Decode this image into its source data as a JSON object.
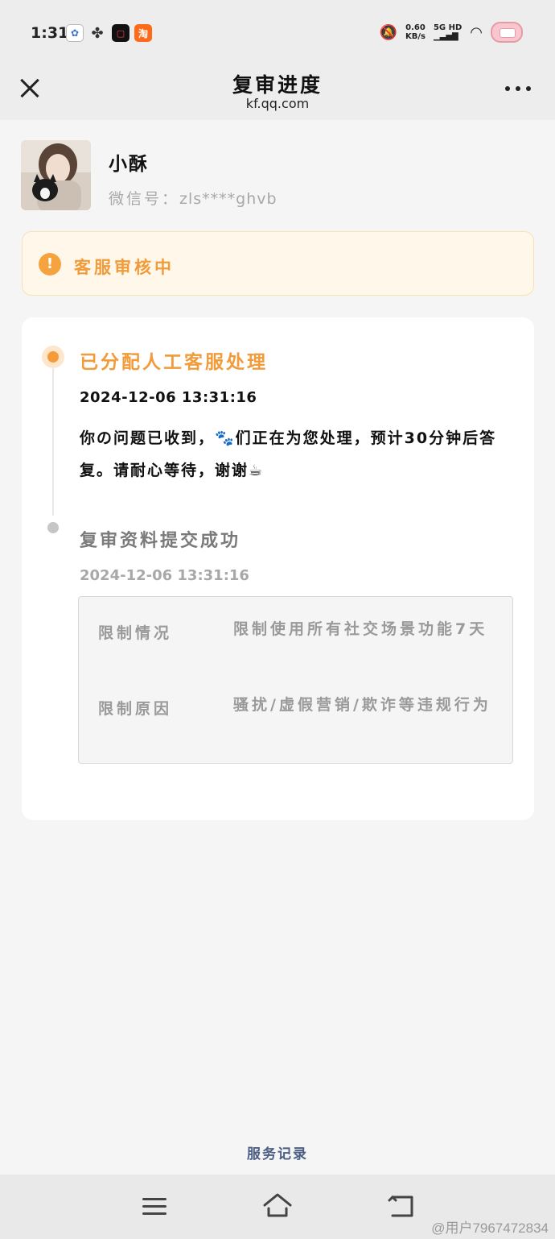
{
  "status_bar": {
    "time": "1:31",
    "net_speed_value": "0.60",
    "net_speed_unit": "KB/s",
    "network": "5G HD",
    "app_icons": [
      "baidu-icon",
      "fan-icon",
      "video-app-icon",
      "taobao-icon"
    ],
    "taobao_glyph": "淘"
  },
  "header": {
    "title": "复审进度",
    "subtitle": "kf.qq.com"
  },
  "profile": {
    "name": "小酥",
    "wechat_label": "微信号：",
    "wechat_id": "zls****ghvb"
  },
  "status": {
    "text": "客服审核中",
    "icon": "!",
    "color": "#f19b3a"
  },
  "timeline": [
    {
      "title": "已分配人工客服处理",
      "time": "2024-12-06 13:31:16",
      "message": "你の问题已收到，🐾们正在为您处理，预计30分钟后答复。请耐心等待，谢谢☕"
    },
    {
      "title": "复审资料提交成功",
      "time": "2024-12-06 13:31:16",
      "details": [
        {
          "label": "限制情况",
          "value": "限制使用所有社交场景功能7天"
        },
        {
          "label": "限制原因",
          "value": "骚扰/虚假营销/欺诈等违规行为"
        }
      ]
    }
  ],
  "footer": {
    "service_link": "服务记录"
  },
  "watermark": "@用户7967472834"
}
